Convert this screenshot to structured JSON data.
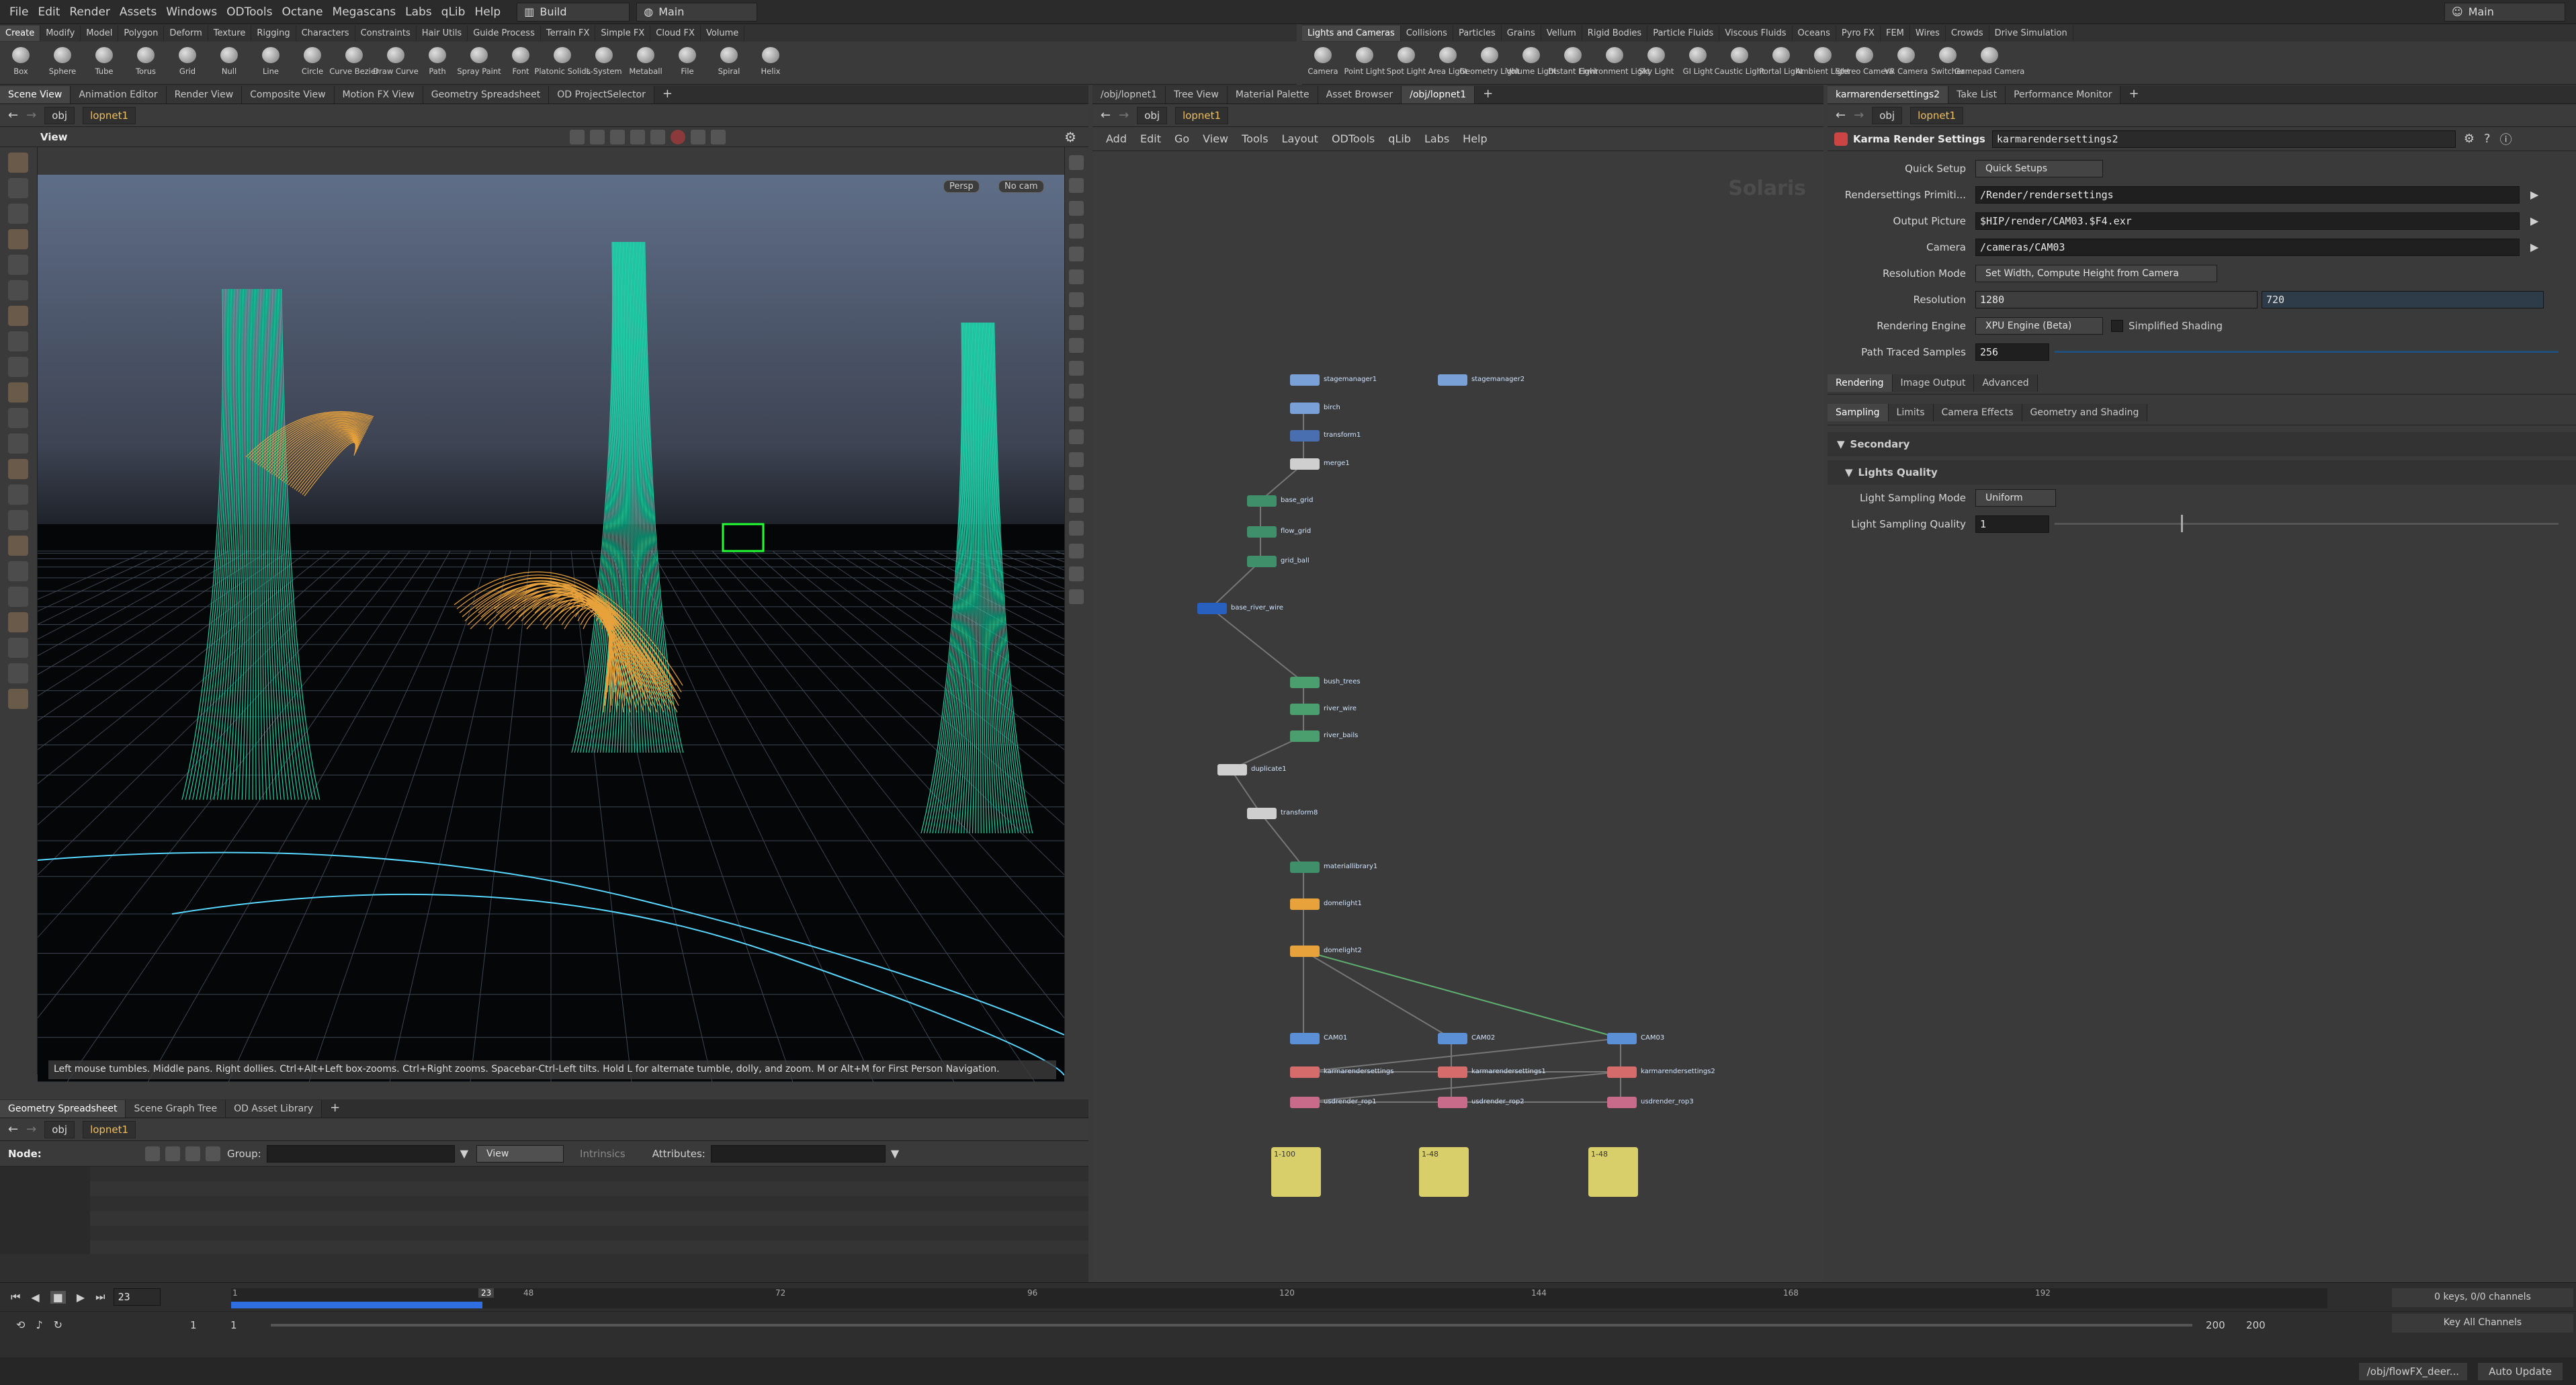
{
  "menubar": {
    "items": [
      "File",
      "Edit",
      "Render",
      "Assets",
      "Windows",
      "ODTools",
      "Octane",
      "Megascans",
      "Labs",
      "qLib",
      "Help"
    ],
    "desktop": "Build",
    "context": "Main",
    "right_desktop": "Main"
  },
  "shelf": {
    "tabs": [
      "Create",
      "Modify",
      "Model",
      "Polygon",
      "Deform",
      "Texture",
      "Rigging",
      "Characters",
      "Constraints",
      "Hair Utils",
      "Guide Process",
      "Terrain FX",
      "Simple FX",
      "Cloud FX",
      "Volume"
    ],
    "tools": [
      "Box",
      "Sphere",
      "Tube",
      "Torus",
      "Grid",
      "Null",
      "Line",
      "Circle",
      "Curve Bezier",
      "Draw Curve",
      "Path",
      "Spray Paint",
      "Font",
      "Platonic Solids",
      "L-System",
      "Metaball",
      "File",
      "Spiral",
      "Helix"
    ]
  },
  "shelf2": {
    "tabs": [
      "Lights and Cameras",
      "Collisions",
      "Particles",
      "Grains",
      "Vellum",
      "Rigid Bodies",
      "Particle Fluids",
      "Viscous Fluids",
      "Oceans",
      "Pyro FX",
      "FEM",
      "Wires",
      "Crowds",
      "Drive Simulation"
    ],
    "tools": [
      "Camera",
      "Point Light",
      "Spot Light",
      "Area Light",
      "Geometry Light",
      "Volume Light",
      "Distant Light",
      "Environment Light",
      "Sky Light",
      "GI Light",
      "Caustic Light",
      "Portal Light",
      "Ambient Light",
      "Stereo Camera",
      "VR Camera",
      "Switcher",
      "Gamepad Camera"
    ]
  },
  "viewer": {
    "tabs": [
      "Scene View",
      "Animation Editor",
      "Render View",
      "Composite View",
      "Motion FX View",
      "Geometry Spreadsheet",
      "OD ProjectSelector"
    ],
    "path": [
      "obj",
      "lopnet1"
    ],
    "label": "View",
    "persp": "Persp",
    "cam": "No cam",
    "status": "Left mouse tumbles. Middle pans. Right dollies. Ctrl+Alt+Left box-zooms. Ctrl+Right zooms. Spacebar-Ctrl-Left tilts. Hold L for alternate tumble, dolly, and zoom.    M or Alt+M for First Person Navigation."
  },
  "spreadsheet": {
    "tabs": [
      "Geometry Spreadsheet",
      "Scene Graph Tree",
      "OD Asset Library"
    ],
    "path": [
      "obj",
      "lopnet1"
    ],
    "node_label": "Node:",
    "group_label": "Group:",
    "view": "View",
    "intrinsics": "Intrinsics",
    "attributes_label": "Attributes:"
  },
  "network": {
    "tabs": [
      "/obj/lopnet1",
      "Tree View",
      "Material Palette",
      "Asset Browser",
      "/obj/lopnet1"
    ],
    "path": [
      "obj",
      "lopnet1"
    ],
    "menu": [
      "Add",
      "Edit",
      "Go",
      "View",
      "Tools",
      "Layout",
      "ODTools",
      "qLib",
      "Labs",
      "Help"
    ],
    "watermark": "Solaris",
    "nodes": [
      "stagemanager1",
      "stagemanager2",
      "birch",
      "transform1",
      "merge1",
      "base_grid",
      "flow_grid",
      "grid_ball",
      "base_river_wire",
      "bush_trees",
      "river_wire",
      "river_bails",
      "duplicate1",
      "transform8",
      "materiallibrary1",
      "domelight1",
      "domelight2",
      "CAM01",
      "CAM02",
      "CAM03",
      "karmarendersettings",
      "karmarendersettings1",
      "karmarendersettings2",
      "usdrender_rop1",
      "usdrender_rop2",
      "usdrender_rop3",
      "1-100",
      "1-48",
      "1-48"
    ]
  },
  "params": {
    "tabs": [
      "karmarendersettings2",
      "Take List",
      "Performance Monitor"
    ],
    "path": [
      "obj",
      "lopnet1"
    ],
    "type": "Karma Render Settings",
    "name": "karmarendersettings2",
    "fields": [
      {
        "label": "Quick Setup",
        "value": "Quick Setups"
      },
      {
        "label": "Rendersettings Primiti...",
        "value": "/Render/rendersettings"
      },
      {
        "label": "Output Picture",
        "value": "$HIP/render/CAM03.$F4.exr"
      },
      {
        "label": "Camera",
        "value": "/cameras/CAM03"
      },
      {
        "label": "Resolution Mode",
        "value": "Set Width, Compute Height from Camera"
      }
    ],
    "resolution": {
      "label": "Resolution",
      "w": "1280",
      "h": "720"
    },
    "engine": {
      "label": "Rendering Engine",
      "value": "XPU Engine (Beta)",
      "simplified": "Simplified Shading"
    },
    "samples": {
      "label": "Path Traced Samples",
      "value": "256",
      "fraction": 0.0
    },
    "tabs1": [
      "Rendering",
      "Image Output",
      "Advanced"
    ],
    "tabs2": [
      "Sampling",
      "Limits",
      "Camera Effects",
      "Geometry and Shading"
    ],
    "secondary": "Secondary",
    "lights_quality": "Lights Quality",
    "light_mode": {
      "label": "Light Sampling Mode",
      "value": "Uniform"
    },
    "light_quality": {
      "label": "Light Sampling Quality",
      "value": "1",
      "fraction": 0.25
    }
  },
  "timeline": {
    "frame": "23",
    "ticks": [
      "1",
      "23",
      "48",
      "72",
      "96",
      "120",
      "144",
      "168",
      "192"
    ],
    "start1": "1",
    "start2": "1",
    "end1": "200",
    "end2": "200",
    "progress": 0.12,
    "keys": "0 keys, 0/0 channels",
    "key_all": "Key All Channels",
    "statuspath": "/obj/flowFX_deer...",
    "auto_update": "Auto Update"
  },
  "colors": {
    "accent_orange": "#e8a23c",
    "node_green": "#3f8f6b",
    "node_blue": "#5b8fd6",
    "sticky": "#d9cf6a"
  }
}
